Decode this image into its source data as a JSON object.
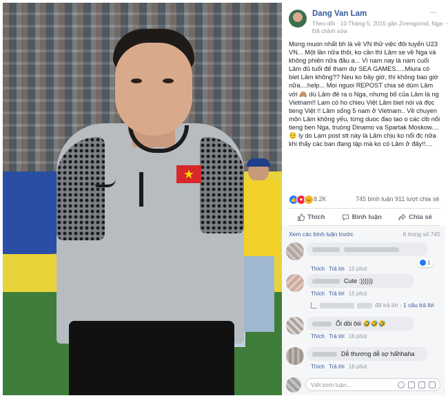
{
  "post": {
    "author": "Dang Van Lam",
    "meta": "Theo dõi · 10 Tháng 5, 2015 gần Zvenigorod, Nga · ",
    "edited": "Đã chỉnh sửa",
    "more": "···",
    "body": "Mong muon nhất bh là về VN thử việc đôi tuyển U23 VN... Một lần nữa thôi, ko cần thì Lâm se về Nga và không phiên nữa đâu a... Vì nam nay là nam cuối Lâm đủ tuổi để tham dự SEA GAMES.....Miura có biet Lâm không?? Neu ko bây giờ, thì không bao giờ nữa....help... Moi nguoi REPOST chia sẻ dùm Lâm với 🙈 dù Lâm đẻ ra o Nga, nhưng bố của Lâm là ng Vietnam!! Lam có ho chieu Việt Lâm biet nói và đọc tieng Việt !! Lâm sống 5 nam ở Vietnam.. Về chuyen môn Lâm không yếu, từng duoc đao tao o các clb nổi tieng ben Nga, truòng Dinamo va Spartak Moskow....😌 ly do Lam post stt này là Lâm chịu ko nổi đc nữa khi thấy các ban đang tập mà ko có Lâm ở đây!!.... "
  },
  "stats": {
    "reactions": "8.2K",
    "comments": "745 bình luận",
    "shares": "911 lượt chia sẻ"
  },
  "actions": {
    "like": "Thích",
    "comment": "Bình luận",
    "share": "Chia sẻ"
  },
  "comments": {
    "view_previous": "Xem các bình luận trước",
    "count": "6 trong số 745",
    "items": [
      {
        "text": "",
        "like": "Thích",
        "reply": "Trả lời",
        "time": "15 phút",
        "likes": "1"
      },
      {
        "text": "Cute :))))))",
        "like": "Thích",
        "reply": "Trả lời",
        "time": "15 phút",
        "reply_label": "đã trả lời",
        "reply_count": "· 1 câu trả lời"
      },
      {
        "text": "Ối dồi ôiii 🤣🤣🤣",
        "like": "Thích",
        "reply": "Trả lời",
        "time": "16 phút"
      },
      {
        "text": "Dễ thương dễ sợ hấhhaha",
        "like": "Thích",
        "reply": "Trả lời",
        "time": "16 phút"
      }
    ],
    "placeholder": "Viết bình luận..."
  },
  "colors": {
    "link": "#365899",
    "like_blue": "#2078f4",
    "love_red": "#f0284a",
    "haha_yellow": "#f7b125"
  }
}
